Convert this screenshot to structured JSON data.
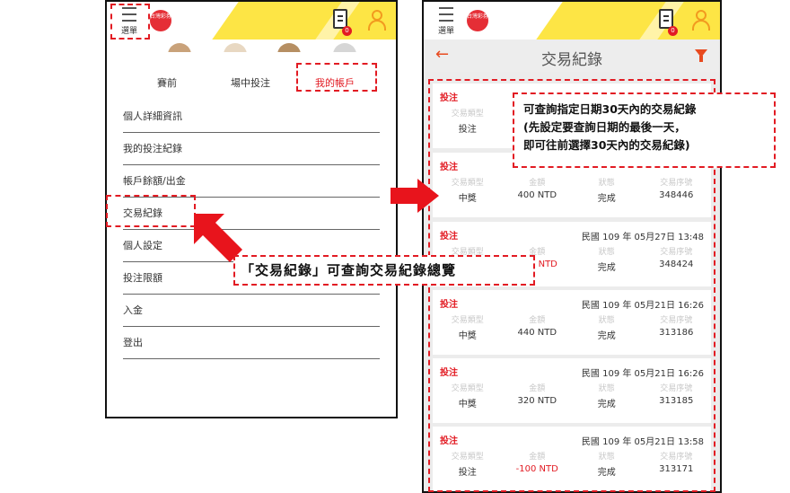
{
  "left_screen": {
    "menu_label": "選單",
    "logo_text": "台灣彩券",
    "cart_badge": "0",
    "tabs": [
      {
        "label": "賽前"
      },
      {
        "label": "場中投注"
      },
      {
        "label": "我的帳戶"
      }
    ],
    "menu_items": [
      {
        "label": "個人詳細資訊"
      },
      {
        "label": "我的投注紀錄"
      },
      {
        "label": "帳戶餘額/出金"
      },
      {
        "label": "交易紀錄"
      },
      {
        "label": "個人設定"
      },
      {
        "label": "投注限額"
      },
      {
        "label": "入金"
      },
      {
        "label": "登出"
      }
    ]
  },
  "right_screen": {
    "menu_label": "選單",
    "logo_text": "台灣彩券",
    "cart_badge": "0",
    "title": "交易紀錄",
    "col_headers": {
      "type": "交易類型",
      "amount": "金額",
      "status": "狀態",
      "serial": "交易序號"
    },
    "records": [
      {
        "kind": "投注",
        "datetime": "",
        "type": "投注",
        "amount": "",
        "status": "",
        "serial": ""
      },
      {
        "kind": "投注",
        "datetime": "",
        "type": "中獎",
        "amount": "400 NTD",
        "status": "完成",
        "serial": "348446"
      },
      {
        "kind": "投注",
        "datetime": "民國 109 年 05月27日 13:48",
        "type": "",
        "amount": "NTD",
        "status": "完成",
        "serial": "348424"
      },
      {
        "kind": "投注",
        "datetime": "民國 109 年 05月21日 16:26",
        "type": "中獎",
        "amount": "440 NTD",
        "status": "完成",
        "serial": "313186"
      },
      {
        "kind": "投注",
        "datetime": "民國 109 年 05月21日 16:26",
        "type": "中獎",
        "amount": "320 NTD",
        "status": "完成",
        "serial": "313185"
      },
      {
        "kind": "投注",
        "datetime": "民國 109 年 05月21日 13:58",
        "type": "投注",
        "amount": "-100 NTD",
        "status": "完成",
        "serial": "313171"
      }
    ]
  },
  "annotations": {
    "left_callout": "「交易紀錄」可查詢交易紀錄總覽",
    "right_callout_lines": [
      "可查詢指定日期30天內的交易紀錄",
      "(先設定要查詢日期的最後一天，",
      "即可往前選擇30天內的交易紀錄)"
    ]
  },
  "colors": {
    "accent_red": "#e21b23",
    "header_yellow": "#fde545",
    "icon_orange": "#f29a1f",
    "arrow_red": "#e8141c"
  },
  "icons": [
    "menu-icon",
    "receipt-icon",
    "user-icon",
    "back-arrow-icon",
    "filter-icon"
  ]
}
